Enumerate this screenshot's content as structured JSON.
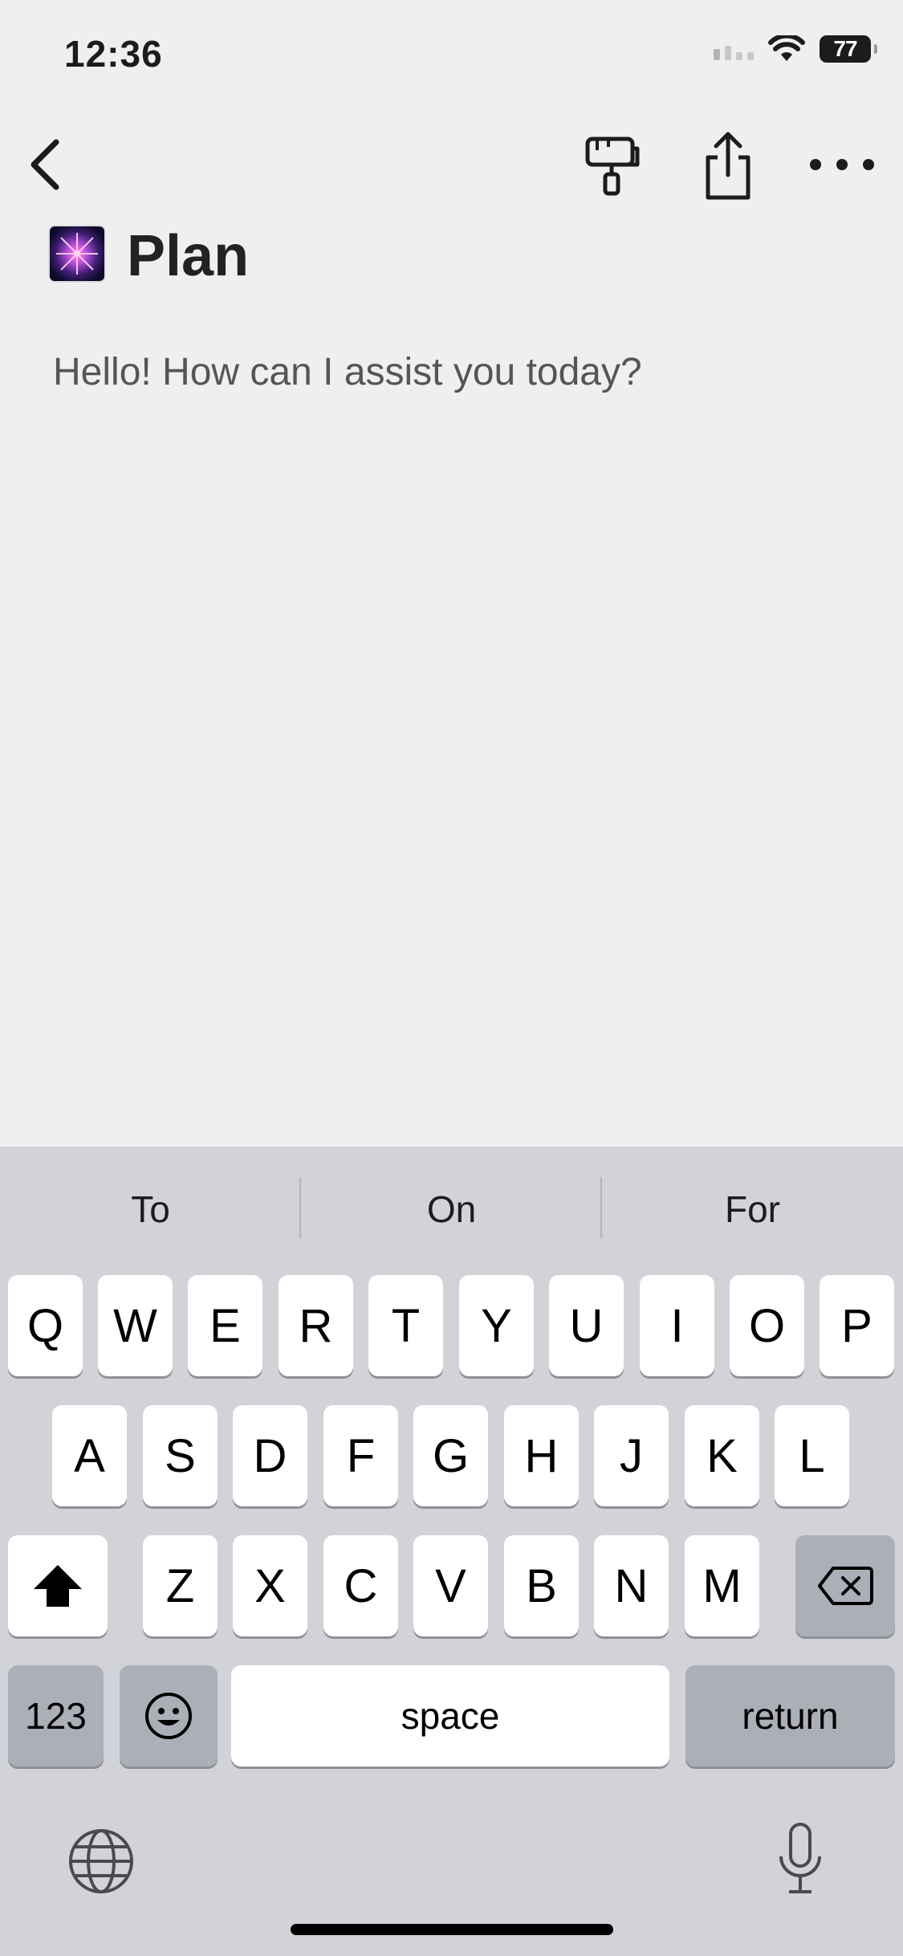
{
  "status_bar": {
    "time": "12:36",
    "battery": "77"
  },
  "nav": {
    "back_icon": "chevron-left-icon",
    "brush_icon": "paint-brush-icon",
    "share_icon": "share-icon",
    "more_icon": "more-horizontal-icon"
  },
  "page": {
    "icon": "fireworks-icon",
    "title": "Plan",
    "body": "Hello! How can I assist you today?"
  },
  "keyboard": {
    "suggestions": [
      "To",
      "On",
      "For"
    ],
    "row1": [
      "Q",
      "W",
      "E",
      "R",
      "T",
      "Y",
      "U",
      "I",
      "O",
      "P"
    ],
    "row2": [
      "A",
      "S",
      "D",
      "F",
      "G",
      "H",
      "J",
      "K",
      "L"
    ],
    "row3": [
      "Z",
      "X",
      "C",
      "V",
      "B",
      "N",
      "M"
    ],
    "numbers_label": "123",
    "space_label": "space",
    "return_label": "return",
    "shift_icon": "shift-icon",
    "delete_icon": "backspace-icon",
    "emoji_icon": "emoji-icon",
    "globe_icon": "globe-icon",
    "mic_icon": "microphone-icon"
  }
}
